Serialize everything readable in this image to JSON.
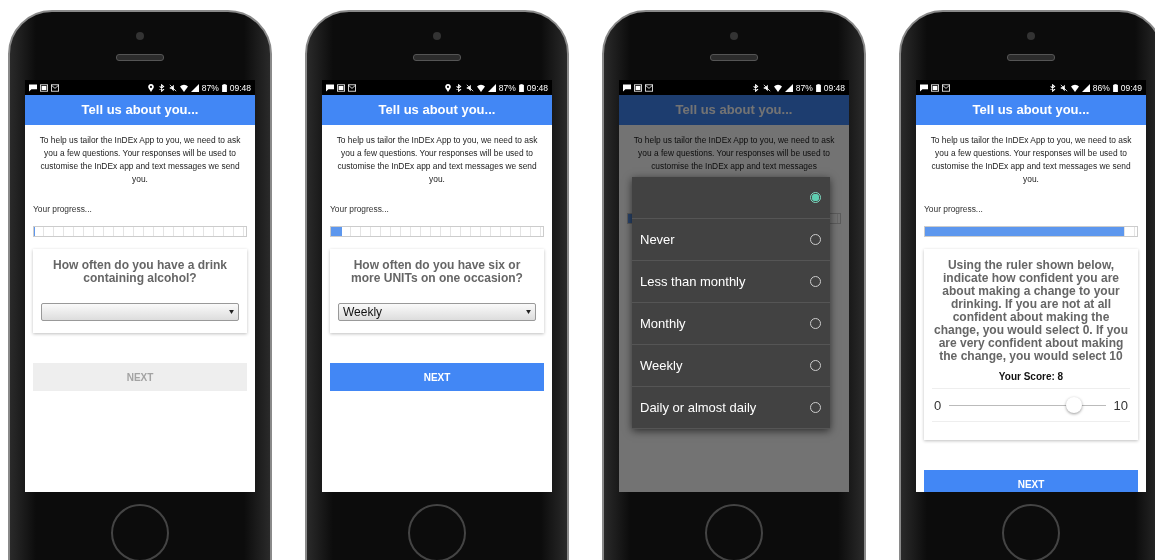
{
  "phones": [
    {
      "status": {
        "location": true,
        "battery": "87%",
        "time": "09:48"
      },
      "header": "Tell us about you...",
      "intro": "To help us tailor the InDEx App to you, we need to ask you a few questions. Your responses will be used to customise the InDEx app and text messages we send you.",
      "progress_label": "Your progress...",
      "progress": {
        "level": 0
      },
      "question": {
        "kind": "select",
        "text": "How often do you have a drink containing alcohol?"
      },
      "next": {
        "label": "NEXT",
        "disabled": true
      }
    },
    {
      "status": {
        "location": true,
        "battery": "87%",
        "time": "09:48"
      },
      "header": "Tell us about you...",
      "intro": "To help us tailor the InDEx App to you, we need to ask you a few questions. Your responses will be used to customise the InDEx app and text messages we send you.",
      "progress_label": "Your progress...",
      "progress": {
        "level": 0.05
      },
      "question": {
        "kind": "select",
        "text": "How often do you have six or more UNITs on one occasion?",
        "value": "Weekly"
      },
      "next": {
        "label": "NEXT",
        "disabled": false
      }
    },
    {
      "status": {
        "location": false,
        "battery": "87%",
        "time": "09:48"
      },
      "header": "Tell us about you...",
      "intro": "To help us tailor the InDEx App to you, we need to ask you a few questions. Your responses will be used to customise the InDEx app and text messages",
      "progress": {
        "level": 0.05
      },
      "dialog": {
        "options": [
          {
            "selected": true
          },
          {
            "label": "Never",
            "selected": false
          },
          {
            "label": "Less than monthly",
            "selected": false
          },
          {
            "label": "Monthly",
            "selected": false
          },
          {
            "label": "Weekly",
            "selected": false
          },
          {
            "label": "Daily or almost daily",
            "selected": false
          }
        ]
      }
    },
    {
      "status": {
        "location": false,
        "battery": "86%",
        "time": "09:49"
      },
      "header": "Tell us about you...",
      "intro": "To help us tailor the InDEx App to you, we need to ask you a few questions. Your responses will be used to customise the InDEx app and text messages we send you.",
      "progress_label": "Your progress...",
      "progress": {
        "level": 0.94
      },
      "question": {
        "kind": "slider",
        "text": "Using the ruler shown below, indicate how confident you are about making a change to your drinking. If you are not at all confident about making the change, you would select 0. If you are very confident about making the change, you would select 10",
        "score": "Your Score: 8",
        "min": "0",
        "max": "10",
        "level": 0.8
      },
      "next": {
        "label": "NEXT",
        "disabled": false
      }
    }
  ]
}
